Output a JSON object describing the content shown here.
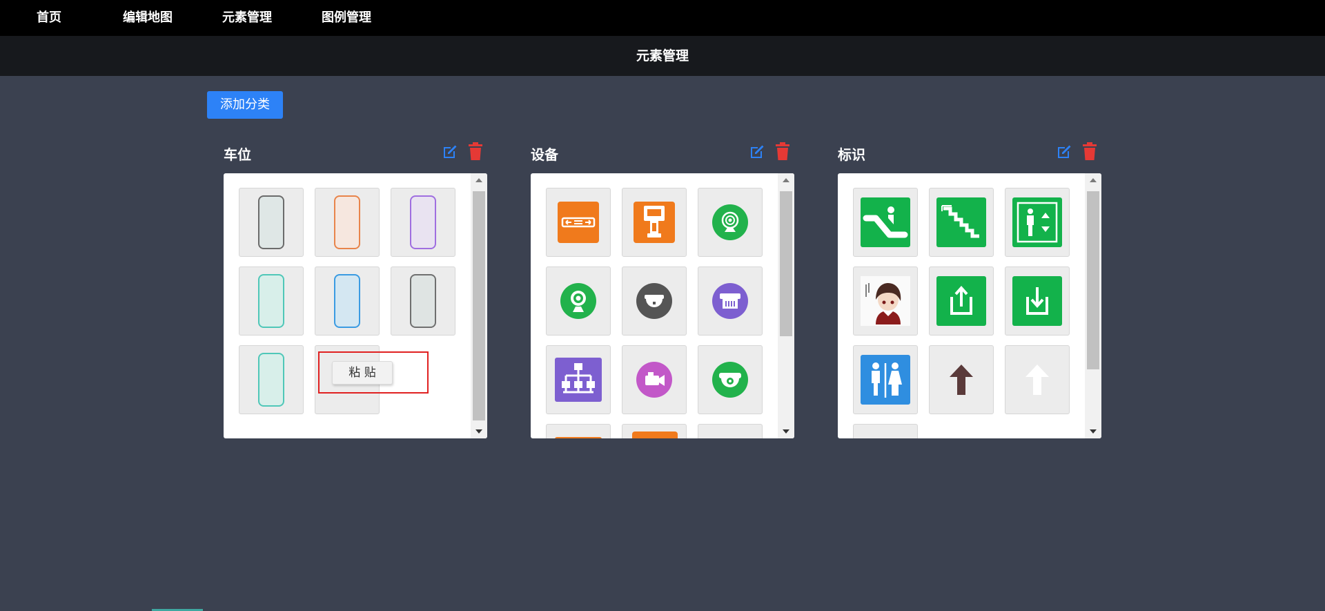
{
  "nav": {
    "items": [
      {
        "label": "首页"
      },
      {
        "label": "编辑地图"
      },
      {
        "label": "元素管理"
      },
      {
        "label": "图例管理"
      }
    ]
  },
  "page": {
    "title": "元素管理"
  },
  "toolbar": {
    "add_label": "添加分类"
  },
  "categories": [
    {
      "title": "车位",
      "tiles": [
        {
          "icon": "parking-slot-gray-icon",
          "color": "#6b6b6b",
          "fill": "#dfe7e6"
        },
        {
          "icon": "parking-slot-orange-icon",
          "color": "#e8844a",
          "fill": "#f6e7df"
        },
        {
          "icon": "parking-slot-purple-icon",
          "color": "#9f6ee0",
          "fill": "#e9e3f1"
        },
        {
          "icon": "parking-slot-teal-icon",
          "color": "#4fc7b8",
          "fill": "#d8efea"
        },
        {
          "icon": "parking-slot-blue-icon",
          "color": "#3a9be2",
          "fill": "#d4e7f2"
        },
        {
          "icon": "parking-slot-darkgray-icon",
          "color": "#6f6f6f",
          "fill": "#dfe4e3"
        },
        {
          "icon": "parking-slot-teal2-icon",
          "color": "#4fc7b8",
          "fill": "#d8efea"
        },
        {
          "icon": "empty-tile",
          "color": "",
          "fill": ""
        }
      ]
    },
    {
      "title": "设备",
      "tiles": [
        {
          "icon": "gate-barrier-icon",
          "color": "#f07a1c"
        },
        {
          "icon": "kiosk-terminal-icon",
          "color": "#f07a1c"
        },
        {
          "icon": "camera-green-icon",
          "color": "#22b24c"
        },
        {
          "icon": "camera-green-2-icon",
          "color": "#22b24c"
        },
        {
          "icon": "dome-camera-icon",
          "color": "#555555"
        },
        {
          "icon": "receipt-printer-icon",
          "color": "#7d5fd0"
        },
        {
          "icon": "network-switch-icon",
          "color": "#7d5fd0"
        },
        {
          "icon": "video-camera-icon",
          "color": "#c258c8"
        },
        {
          "icon": "dome-camera-green-icon",
          "color": "#22b24c"
        }
      ]
    },
    {
      "title": "标识",
      "tiles": [
        {
          "icon": "escalator-sign-icon",
          "color": "#13b24b"
        },
        {
          "icon": "stairs-sign-icon",
          "color": "#13b24b"
        },
        {
          "icon": "elevator-sign-icon",
          "color": "#13b24b"
        },
        {
          "icon": "avatar-image-icon",
          "color": "#8b3a3a"
        },
        {
          "icon": "exit-up-sign-icon",
          "color": "#13b24b"
        },
        {
          "icon": "entrance-down-sign-icon",
          "color": "#13b24b"
        },
        {
          "icon": "restroom-sign-icon",
          "color": "#2f8ee0"
        },
        {
          "icon": "arrow-up-brown-icon",
          "color": "#5a3a3a"
        },
        {
          "icon": "arrow-up-white-icon",
          "color": "#ffffff"
        }
      ]
    }
  ],
  "context_menu": {
    "paste_label": "粘 贴"
  }
}
